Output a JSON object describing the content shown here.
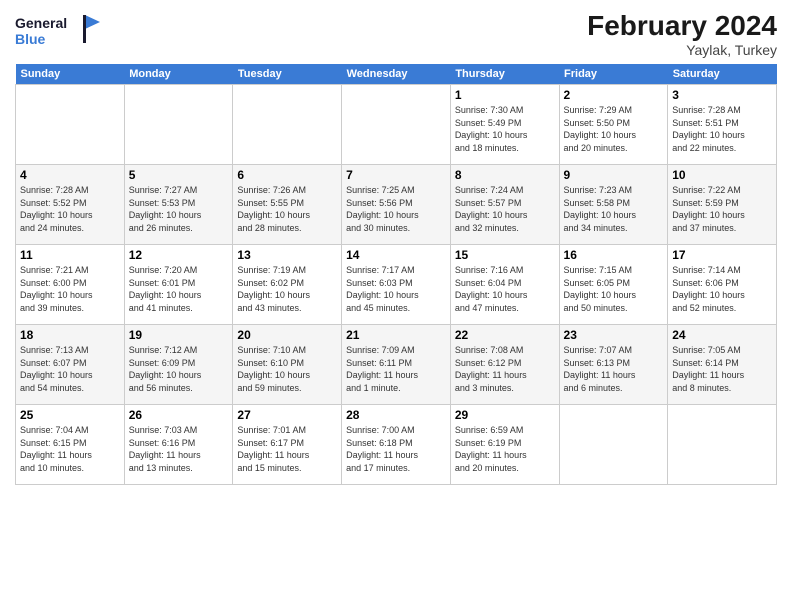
{
  "logo": {
    "line1": "General",
    "line2": "Blue"
  },
  "header": {
    "title": "February 2024",
    "subtitle": "Yaylak, Turkey"
  },
  "weekdays": [
    "Sunday",
    "Monday",
    "Tuesday",
    "Wednesday",
    "Thursday",
    "Friday",
    "Saturday"
  ],
  "weeks": [
    [
      {
        "day": "",
        "info": ""
      },
      {
        "day": "",
        "info": ""
      },
      {
        "day": "",
        "info": ""
      },
      {
        "day": "",
        "info": ""
      },
      {
        "day": "1",
        "info": "Sunrise: 7:30 AM\nSunset: 5:49 PM\nDaylight: 10 hours\nand 18 minutes."
      },
      {
        "day": "2",
        "info": "Sunrise: 7:29 AM\nSunset: 5:50 PM\nDaylight: 10 hours\nand 20 minutes."
      },
      {
        "day": "3",
        "info": "Sunrise: 7:28 AM\nSunset: 5:51 PM\nDaylight: 10 hours\nand 22 minutes."
      }
    ],
    [
      {
        "day": "4",
        "info": "Sunrise: 7:28 AM\nSunset: 5:52 PM\nDaylight: 10 hours\nand 24 minutes."
      },
      {
        "day": "5",
        "info": "Sunrise: 7:27 AM\nSunset: 5:53 PM\nDaylight: 10 hours\nand 26 minutes."
      },
      {
        "day": "6",
        "info": "Sunrise: 7:26 AM\nSunset: 5:55 PM\nDaylight: 10 hours\nand 28 minutes."
      },
      {
        "day": "7",
        "info": "Sunrise: 7:25 AM\nSunset: 5:56 PM\nDaylight: 10 hours\nand 30 minutes."
      },
      {
        "day": "8",
        "info": "Sunrise: 7:24 AM\nSunset: 5:57 PM\nDaylight: 10 hours\nand 32 minutes."
      },
      {
        "day": "9",
        "info": "Sunrise: 7:23 AM\nSunset: 5:58 PM\nDaylight: 10 hours\nand 34 minutes."
      },
      {
        "day": "10",
        "info": "Sunrise: 7:22 AM\nSunset: 5:59 PM\nDaylight: 10 hours\nand 37 minutes."
      }
    ],
    [
      {
        "day": "11",
        "info": "Sunrise: 7:21 AM\nSunset: 6:00 PM\nDaylight: 10 hours\nand 39 minutes."
      },
      {
        "day": "12",
        "info": "Sunrise: 7:20 AM\nSunset: 6:01 PM\nDaylight: 10 hours\nand 41 minutes."
      },
      {
        "day": "13",
        "info": "Sunrise: 7:19 AM\nSunset: 6:02 PM\nDaylight: 10 hours\nand 43 minutes."
      },
      {
        "day": "14",
        "info": "Sunrise: 7:17 AM\nSunset: 6:03 PM\nDaylight: 10 hours\nand 45 minutes."
      },
      {
        "day": "15",
        "info": "Sunrise: 7:16 AM\nSunset: 6:04 PM\nDaylight: 10 hours\nand 47 minutes."
      },
      {
        "day": "16",
        "info": "Sunrise: 7:15 AM\nSunset: 6:05 PM\nDaylight: 10 hours\nand 50 minutes."
      },
      {
        "day": "17",
        "info": "Sunrise: 7:14 AM\nSunset: 6:06 PM\nDaylight: 10 hours\nand 52 minutes."
      }
    ],
    [
      {
        "day": "18",
        "info": "Sunrise: 7:13 AM\nSunset: 6:07 PM\nDaylight: 10 hours\nand 54 minutes."
      },
      {
        "day": "19",
        "info": "Sunrise: 7:12 AM\nSunset: 6:09 PM\nDaylight: 10 hours\nand 56 minutes."
      },
      {
        "day": "20",
        "info": "Sunrise: 7:10 AM\nSunset: 6:10 PM\nDaylight: 10 hours\nand 59 minutes."
      },
      {
        "day": "21",
        "info": "Sunrise: 7:09 AM\nSunset: 6:11 PM\nDaylight: 11 hours\nand 1 minute."
      },
      {
        "day": "22",
        "info": "Sunrise: 7:08 AM\nSunset: 6:12 PM\nDaylight: 11 hours\nand 3 minutes."
      },
      {
        "day": "23",
        "info": "Sunrise: 7:07 AM\nSunset: 6:13 PM\nDaylight: 11 hours\nand 6 minutes."
      },
      {
        "day": "24",
        "info": "Sunrise: 7:05 AM\nSunset: 6:14 PM\nDaylight: 11 hours\nand 8 minutes."
      }
    ],
    [
      {
        "day": "25",
        "info": "Sunrise: 7:04 AM\nSunset: 6:15 PM\nDaylight: 11 hours\nand 10 minutes."
      },
      {
        "day": "26",
        "info": "Sunrise: 7:03 AM\nSunset: 6:16 PM\nDaylight: 11 hours\nand 13 minutes."
      },
      {
        "day": "27",
        "info": "Sunrise: 7:01 AM\nSunset: 6:17 PM\nDaylight: 11 hours\nand 15 minutes."
      },
      {
        "day": "28",
        "info": "Sunrise: 7:00 AM\nSunset: 6:18 PM\nDaylight: 11 hours\nand 17 minutes."
      },
      {
        "day": "29",
        "info": "Sunrise: 6:59 AM\nSunset: 6:19 PM\nDaylight: 11 hours\nand 20 minutes."
      },
      {
        "day": "",
        "info": ""
      },
      {
        "day": "",
        "info": ""
      }
    ]
  ]
}
